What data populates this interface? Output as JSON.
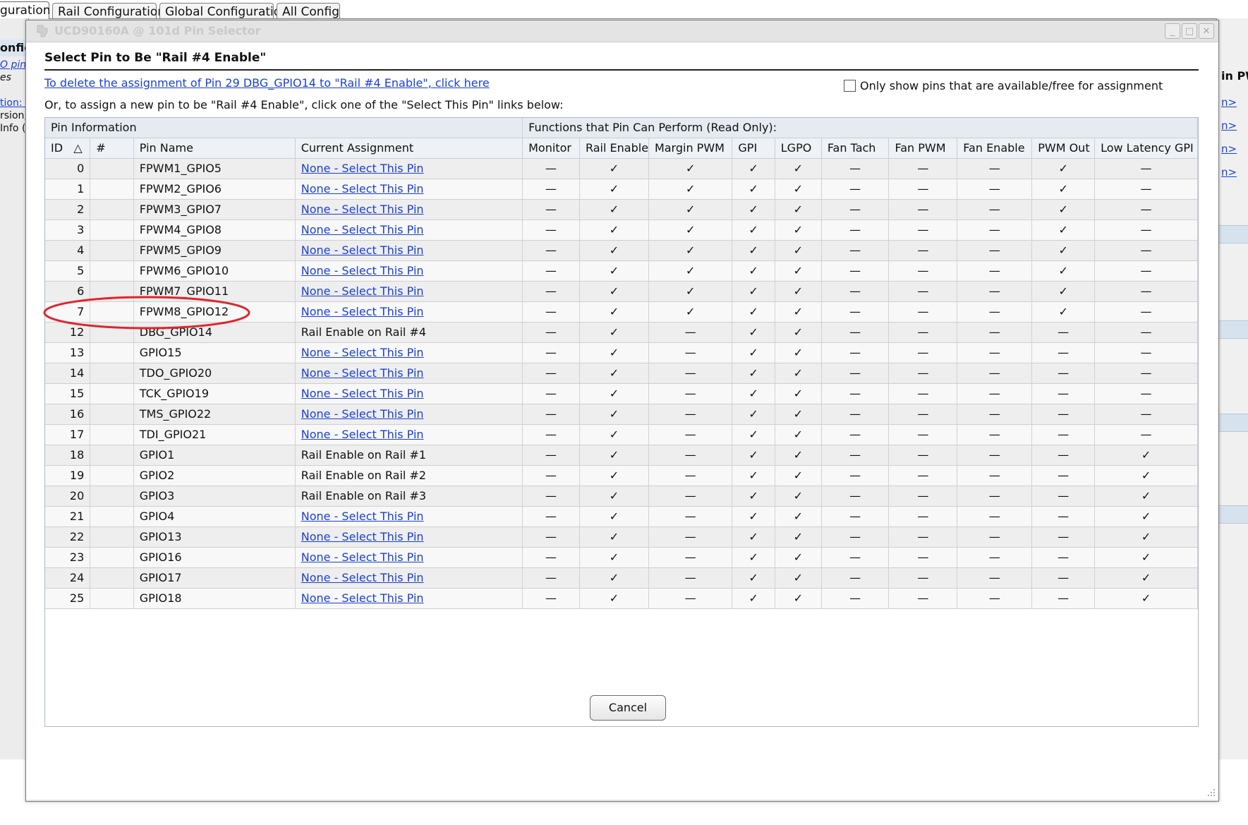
{
  "background": {
    "tabs": [
      "guration",
      "Rail Configuration",
      "Global Configuration",
      "All Config"
    ],
    "left_panel": {
      "header": "onfig",
      "link": "O pin",
      "text": [
        "es",
        "tion: I",
        "rsion,",
        "Info ("
      ]
    },
    "right_panel": {
      "header": "in PW",
      "links": [
        "n>",
        "n>",
        "n>",
        "n>"
      ]
    }
  },
  "dialog": {
    "title": "UCD90160A @ 101d Pin Selector",
    "heading": "Select Pin to Be \"Rail #4 Enable\"",
    "delete_link": "To delete the assignment of Pin 29 DBG_GPIO14 to \"Rail #4 Enable\", click here",
    "instruction": "Or, to assign a new pin to be \"Rail #4 Enable\", click one of the \"Select This Pin\" links below:",
    "filter_label": "Only show pins that are available/free for assignment",
    "filter_checked": false,
    "cancel_label": "Cancel",
    "window_buttons": {
      "minimize": "_",
      "maximize": "□",
      "close": "✕"
    }
  },
  "table": {
    "group_headers": {
      "pin_info": "Pin Information",
      "functions": "Functions that Pin Can Perform (Read Only):"
    },
    "columns": {
      "id": "ID",
      "sort_indicator": "△",
      "num": "#",
      "name": "Pin Name",
      "assignment": "Current Assignment",
      "monitor": "Monitor",
      "rail_enable": "Rail Enable",
      "margin_pwm": "Margin PWM",
      "gpi": "GPI",
      "lgpo": "LGPO",
      "fan_tach": "Fan Tach",
      "fan_pwm": "Fan PWM",
      "fan_enable": "Fan Enable",
      "pwm_out": "PWM Out",
      "low_latency_gpi": "Low Latency GPI"
    },
    "symbols": {
      "yes": "✓",
      "no": "—"
    },
    "rows": [
      {
        "id": "0",
        "name": "FPWM1_GPIO5",
        "assignment": "None - Select This Pin",
        "selectable": true,
        "caps": [
          0,
          1,
          1,
          1,
          1,
          0,
          0,
          0,
          1,
          0
        ]
      },
      {
        "id": "1",
        "name": "FPWM2_GPIO6",
        "assignment": "None - Select This Pin",
        "selectable": true,
        "caps": [
          0,
          1,
          1,
          1,
          1,
          0,
          0,
          0,
          1,
          0
        ]
      },
      {
        "id": "2",
        "name": "FPWM3_GPIO7",
        "assignment": "None - Select This Pin",
        "selectable": true,
        "caps": [
          0,
          1,
          1,
          1,
          1,
          0,
          0,
          0,
          1,
          0
        ]
      },
      {
        "id": "3",
        "name": "FPWM4_GPIO8",
        "assignment": "None - Select This Pin",
        "selectable": true,
        "caps": [
          0,
          1,
          1,
          1,
          1,
          0,
          0,
          0,
          1,
          0
        ]
      },
      {
        "id": "4",
        "name": "FPWM5_GPIO9",
        "assignment": "None - Select This Pin",
        "selectable": true,
        "caps": [
          0,
          1,
          1,
          1,
          1,
          0,
          0,
          0,
          1,
          0
        ]
      },
      {
        "id": "5",
        "name": "FPWM6_GPIO10",
        "assignment": "None - Select This Pin",
        "selectable": true,
        "caps": [
          0,
          1,
          1,
          1,
          1,
          0,
          0,
          0,
          1,
          0
        ]
      },
      {
        "id": "6",
        "name": "FPWM7_GPIO11",
        "assignment": "None - Select This Pin",
        "selectable": true,
        "caps": [
          0,
          1,
          1,
          1,
          1,
          0,
          0,
          0,
          1,
          0
        ]
      },
      {
        "id": "7",
        "name": "FPWM8_GPIO12",
        "assignment": "None - Select This Pin",
        "selectable": true,
        "caps": [
          0,
          1,
          1,
          1,
          1,
          0,
          0,
          0,
          1,
          0
        ]
      },
      {
        "id": "12",
        "name": "DBG_GPIO14",
        "assignment": "Rail Enable on Rail #4",
        "selectable": false,
        "caps": [
          0,
          1,
          0,
          1,
          1,
          0,
          0,
          0,
          0,
          0
        ]
      },
      {
        "id": "13",
        "name": "GPIO15",
        "assignment": "None - Select This Pin",
        "selectable": true,
        "caps": [
          0,
          1,
          0,
          1,
          1,
          0,
          0,
          0,
          0,
          0
        ]
      },
      {
        "id": "14",
        "name": "TDO_GPIO20",
        "assignment": "None - Select This Pin",
        "selectable": true,
        "caps": [
          0,
          1,
          0,
          1,
          1,
          0,
          0,
          0,
          0,
          0
        ]
      },
      {
        "id": "15",
        "name": "TCK_GPIO19",
        "assignment": "None - Select This Pin",
        "selectable": true,
        "caps": [
          0,
          1,
          0,
          1,
          1,
          0,
          0,
          0,
          0,
          0
        ]
      },
      {
        "id": "16",
        "name": "TMS_GPIO22",
        "assignment": "None - Select This Pin",
        "selectable": true,
        "caps": [
          0,
          1,
          0,
          1,
          1,
          0,
          0,
          0,
          0,
          0
        ]
      },
      {
        "id": "17",
        "name": "TDI_GPIO21",
        "assignment": "None - Select This Pin",
        "selectable": true,
        "caps": [
          0,
          1,
          0,
          1,
          1,
          0,
          0,
          0,
          0,
          0
        ]
      },
      {
        "id": "18",
        "name": "GPIO1",
        "assignment": "Rail Enable on Rail #1",
        "selectable": false,
        "caps": [
          0,
          1,
          0,
          1,
          1,
          0,
          0,
          0,
          0,
          1
        ]
      },
      {
        "id": "19",
        "name": "GPIO2",
        "assignment": "Rail Enable on Rail #2",
        "selectable": false,
        "caps": [
          0,
          1,
          0,
          1,
          1,
          0,
          0,
          0,
          0,
          1
        ]
      },
      {
        "id": "20",
        "name": "GPIO3",
        "assignment": "Rail Enable on Rail #3",
        "selectable": false,
        "caps": [
          0,
          1,
          0,
          1,
          1,
          0,
          0,
          0,
          0,
          1
        ]
      },
      {
        "id": "21",
        "name": "GPIO4",
        "assignment": "None - Select This Pin",
        "selectable": true,
        "caps": [
          0,
          1,
          0,
          1,
          1,
          0,
          0,
          0,
          0,
          1
        ]
      },
      {
        "id": "22",
        "name": "GPIO13",
        "assignment": "None - Select This Pin",
        "selectable": true,
        "caps": [
          0,
          1,
          0,
          1,
          1,
          0,
          0,
          0,
          0,
          1
        ]
      },
      {
        "id": "23",
        "name": "GPIO16",
        "assignment": "None - Select This Pin",
        "selectable": true,
        "caps": [
          0,
          1,
          0,
          1,
          1,
          0,
          0,
          0,
          0,
          1
        ]
      },
      {
        "id": "24",
        "name": "GPIO17",
        "assignment": "None - Select This Pin",
        "selectable": true,
        "caps": [
          0,
          1,
          0,
          1,
          1,
          0,
          0,
          0,
          0,
          1
        ]
      },
      {
        "id": "25",
        "name": "GPIO18",
        "assignment": "None - Select This Pin",
        "selectable": true,
        "caps": [
          0,
          1,
          0,
          1,
          1,
          0,
          0,
          0,
          0,
          1
        ]
      }
    ]
  },
  "annotation": {
    "highlighted_row_id": "12",
    "color": "#e0242b"
  },
  "colors": {
    "link": "#1a3fd6",
    "annotation": "#e0242b",
    "table_border": "#a9b9c9"
  }
}
